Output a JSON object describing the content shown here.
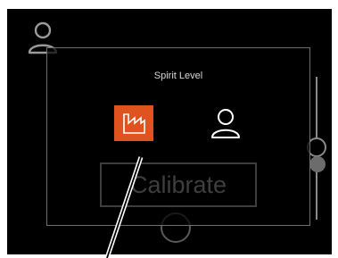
{
  "modal": {
    "title": "Spirit Level",
    "calibrate_label": "Calibrate",
    "modes": [
      {
        "icon": "factory-icon",
        "selected": true
      },
      {
        "icon": "person-icon",
        "selected": false
      }
    ]
  },
  "colors": {
    "accent": "#e0531f",
    "background": "#000000",
    "modal_border": "#6e6e6e",
    "disabled": "#3e3e3e"
  }
}
